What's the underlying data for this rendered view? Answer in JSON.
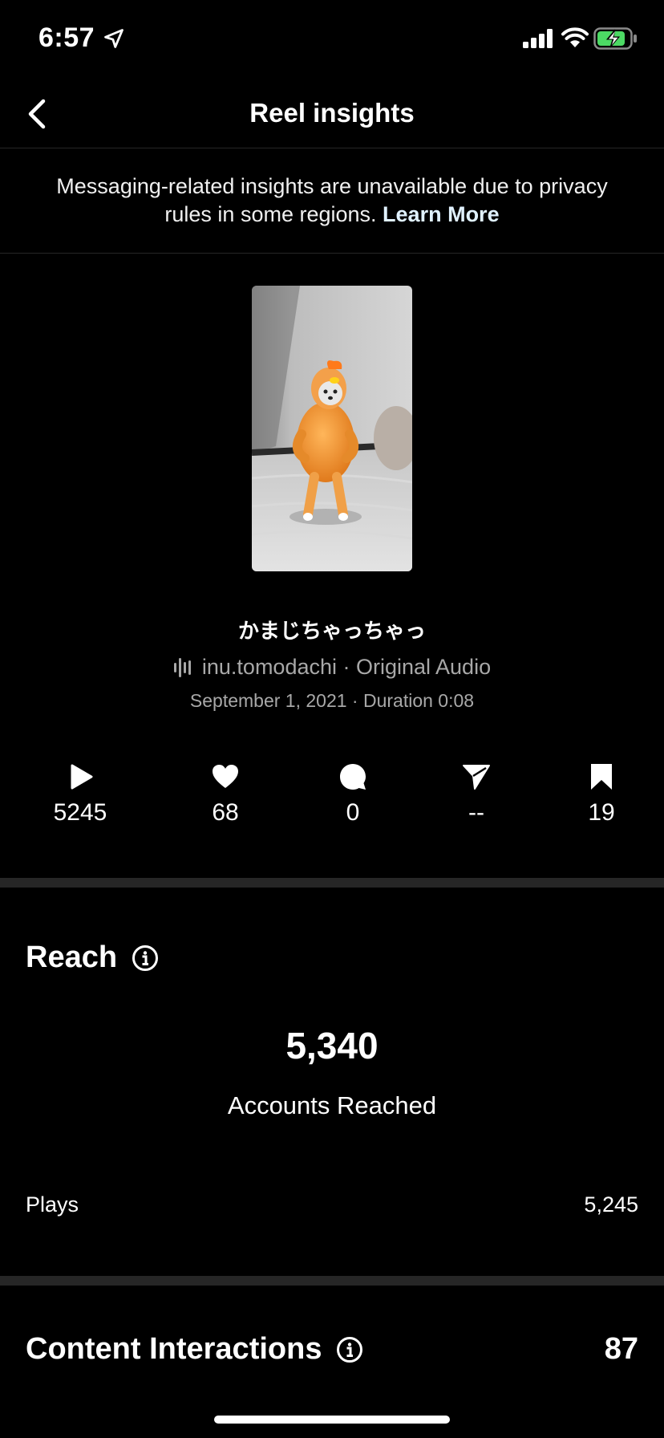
{
  "status_bar": {
    "time": "6:57"
  },
  "nav": {
    "title": "Reel insights"
  },
  "privacy_notice": {
    "text": "Messaging-related insights are unavailable due to privacy rules in some regions.",
    "link": "Learn More"
  },
  "reel": {
    "caption": "かまじちゃっちゃっ",
    "audio": "inu.tomodachi · Original Audio",
    "date_duration": "September 1, 2021 · Duration 0:08"
  },
  "stats": [
    {
      "icon": "play-icon",
      "value": "5245"
    },
    {
      "icon": "heart-icon",
      "value": "68"
    },
    {
      "icon": "comment-icon",
      "value": "0"
    },
    {
      "icon": "share-icon",
      "value": "--"
    },
    {
      "icon": "bookmark-icon",
      "value": "19"
    }
  ],
  "reach": {
    "title": "Reach",
    "accounts_reached": "5,340",
    "accounts_reached_label": "Accounts Reached",
    "plays_label": "Plays",
    "plays_value": "5,245"
  },
  "content_interactions": {
    "title": "Content Interactions",
    "value": "87"
  }
}
